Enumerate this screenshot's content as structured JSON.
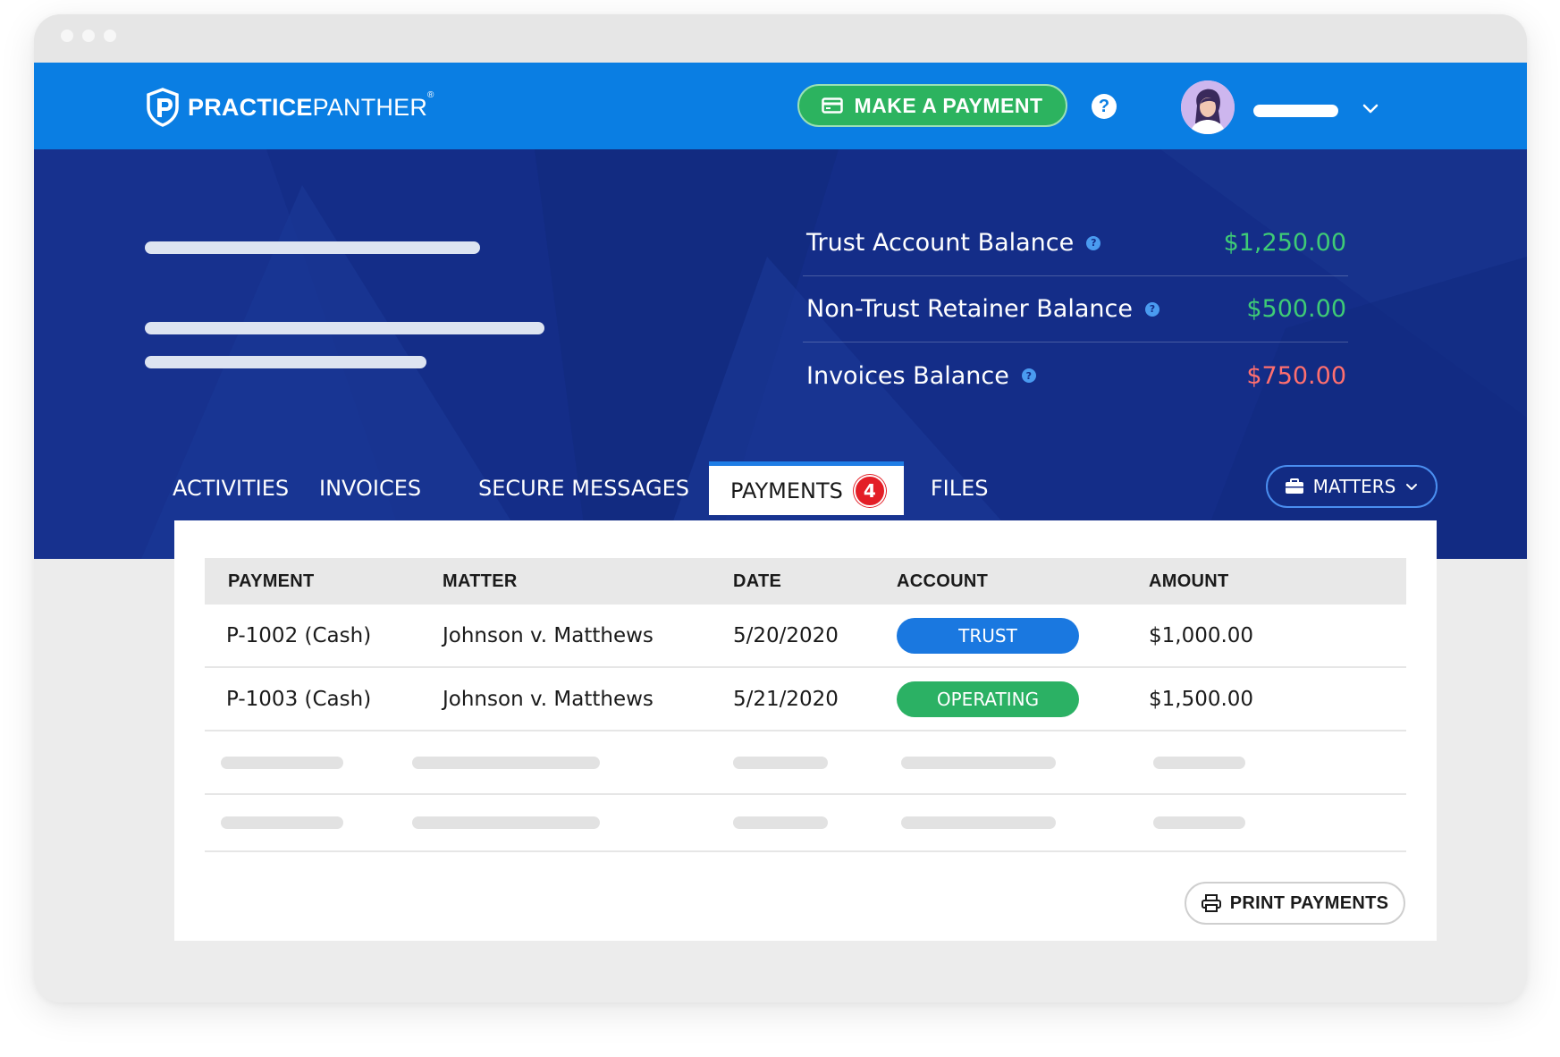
{
  "brand": {
    "name_bold": "PRACTICE",
    "name_light": "PANTHER",
    "registered": "®"
  },
  "header": {
    "make_payment_label": "MAKE A PAYMENT",
    "help_label": "?"
  },
  "balances": [
    {
      "label": "Trust Account Balance",
      "value": "$1,250.00",
      "color": "#3ecb76"
    },
    {
      "label": "Non-Trust Retainer Balance",
      "value": "$500.00",
      "color": "#3ecb76"
    },
    {
      "label": "Invoices Balance",
      "value": "$750.00",
      "color": "#ff6f6f"
    }
  ],
  "tabs": [
    {
      "label": "ACTIVITIES"
    },
    {
      "label": "INVOICES"
    },
    {
      "label": "SECURE MESSAGES"
    },
    {
      "label": "PAYMENTS",
      "badge": "4",
      "active": true
    },
    {
      "label": "FILES"
    }
  ],
  "matters_label": "MATTERS",
  "table": {
    "headers": [
      "PAYMENT",
      "MATTER",
      "DATE",
      "ACCOUNT",
      "AMOUNT"
    ],
    "rows": [
      {
        "payment": "P-1002 (Cash)",
        "matter": "Johnson v. Matthews",
        "date": "5/20/2020",
        "account": "TRUST",
        "amount": "$1,000.00"
      },
      {
        "payment": "P-1003 (Cash)",
        "matter": "Johnson v. Matthews",
        "date": "5/21/2020",
        "account": "OPERATING",
        "amount": "$1,500.00"
      }
    ]
  },
  "print_label": "PRINT PAYMENTS",
  "colors": {
    "topbar": "#0a7ee3",
    "hero": "#142d88",
    "accent_green": "#2cb35f",
    "trust_blue": "#1a78e0",
    "badge_red": "#e31e26"
  },
  "icons": [
    "credit-card-icon",
    "help-icon",
    "chevron-down-icon",
    "info-icon",
    "briefcase-icon",
    "printer-icon",
    "avatar"
  ]
}
